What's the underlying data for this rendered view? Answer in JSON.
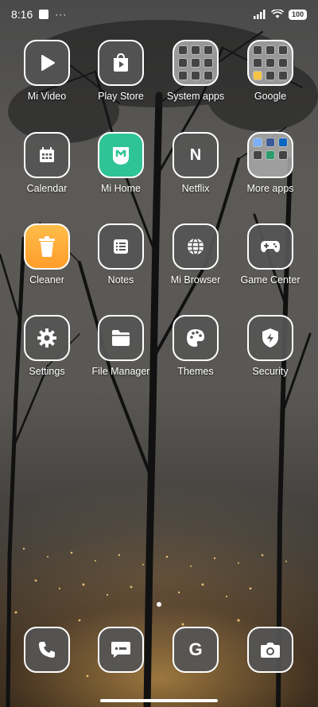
{
  "status_bar": {
    "time": "8:16",
    "more": "···",
    "battery": "100"
  },
  "apps": [
    {
      "label": "Mi Video",
      "icon": "play-icon"
    },
    {
      "label": "Play Store",
      "icon": "play-store-icon"
    },
    {
      "label": "System apps",
      "icon": "folder-icon"
    },
    {
      "label": "Google",
      "icon": "folder-icon"
    },
    {
      "label": "Calendar",
      "icon": "calendar-icon"
    },
    {
      "label": "Mi Home",
      "icon": "mi-home-icon"
    },
    {
      "label": "Netflix",
      "icon": "netflix-icon"
    },
    {
      "label": "More apps",
      "icon": "folder-icon"
    },
    {
      "label": "Cleaner",
      "icon": "trash-icon"
    },
    {
      "label": "Notes",
      "icon": "notes-icon"
    },
    {
      "label": "Mi Browser",
      "icon": "globe-icon"
    },
    {
      "label": "Game Center",
      "icon": "gamepad-icon"
    },
    {
      "label": "Settings",
      "icon": "gear-icon"
    },
    {
      "label": "File Manager",
      "icon": "folder-file-icon"
    },
    {
      "label": "Themes",
      "icon": "palette-icon"
    },
    {
      "label": "Security",
      "icon": "shield-icon"
    }
  ],
  "dock": [
    {
      "icon": "phone-icon"
    },
    {
      "icon": "message-icon"
    },
    {
      "icon": "google-icon"
    },
    {
      "icon": "camera-icon"
    }
  ],
  "netflix_letter": "N",
  "google_letter": "G"
}
